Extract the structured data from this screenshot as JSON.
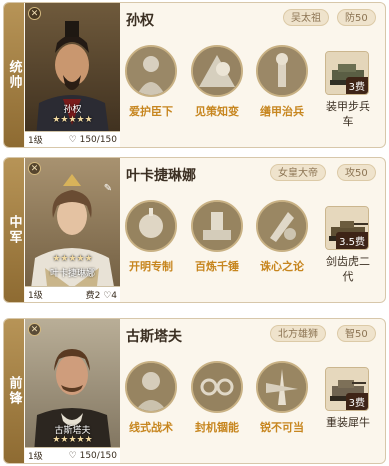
{
  "generals": [
    {
      "role": "统帅",
      "name": "孙权",
      "portrait_name": "孙权",
      "stars": "★★★★★",
      "level": "1级",
      "foot_right": "150/150",
      "badges": [
        "吴太祖",
        "防50"
      ],
      "skills": [
        "爱护臣下",
        "见策知变",
        "缮甲治兵"
      ],
      "troop": {
        "label": "装甲步兵车",
        "cost": "3费"
      }
    },
    {
      "role": "中军",
      "name": "叶卡捷琳娜",
      "portrait_name": "叶卡捷琳娜",
      "stars": "★★★★★",
      "level": "1级",
      "foot_right": "费2",
      "foot_extra": "4",
      "badges": [
        "女皇大帝",
        "攻50"
      ],
      "skills": [
        "开明专制",
        "百炼千锤",
        "诛心之论"
      ],
      "troop": {
        "label": "剑齿虎二代",
        "cost": "3.5费"
      }
    },
    {
      "role": "前锋",
      "name": "古斯塔夫",
      "portrait_name": "古斯塔夫",
      "stars": "★★★★★",
      "level": "1级",
      "foot_right": "150/150",
      "badges": [
        "北方雄狮",
        "智50"
      ],
      "skills": [
        "线式战术",
        "封机锢能",
        "锐不可当"
      ],
      "troop": {
        "label": "重装犀牛",
        "cost": "3费"
      }
    }
  ],
  "colors": {
    "role_tab": "#9c7a40",
    "skill_label": "#c7861f",
    "card_bg": "#fbf6ec"
  }
}
